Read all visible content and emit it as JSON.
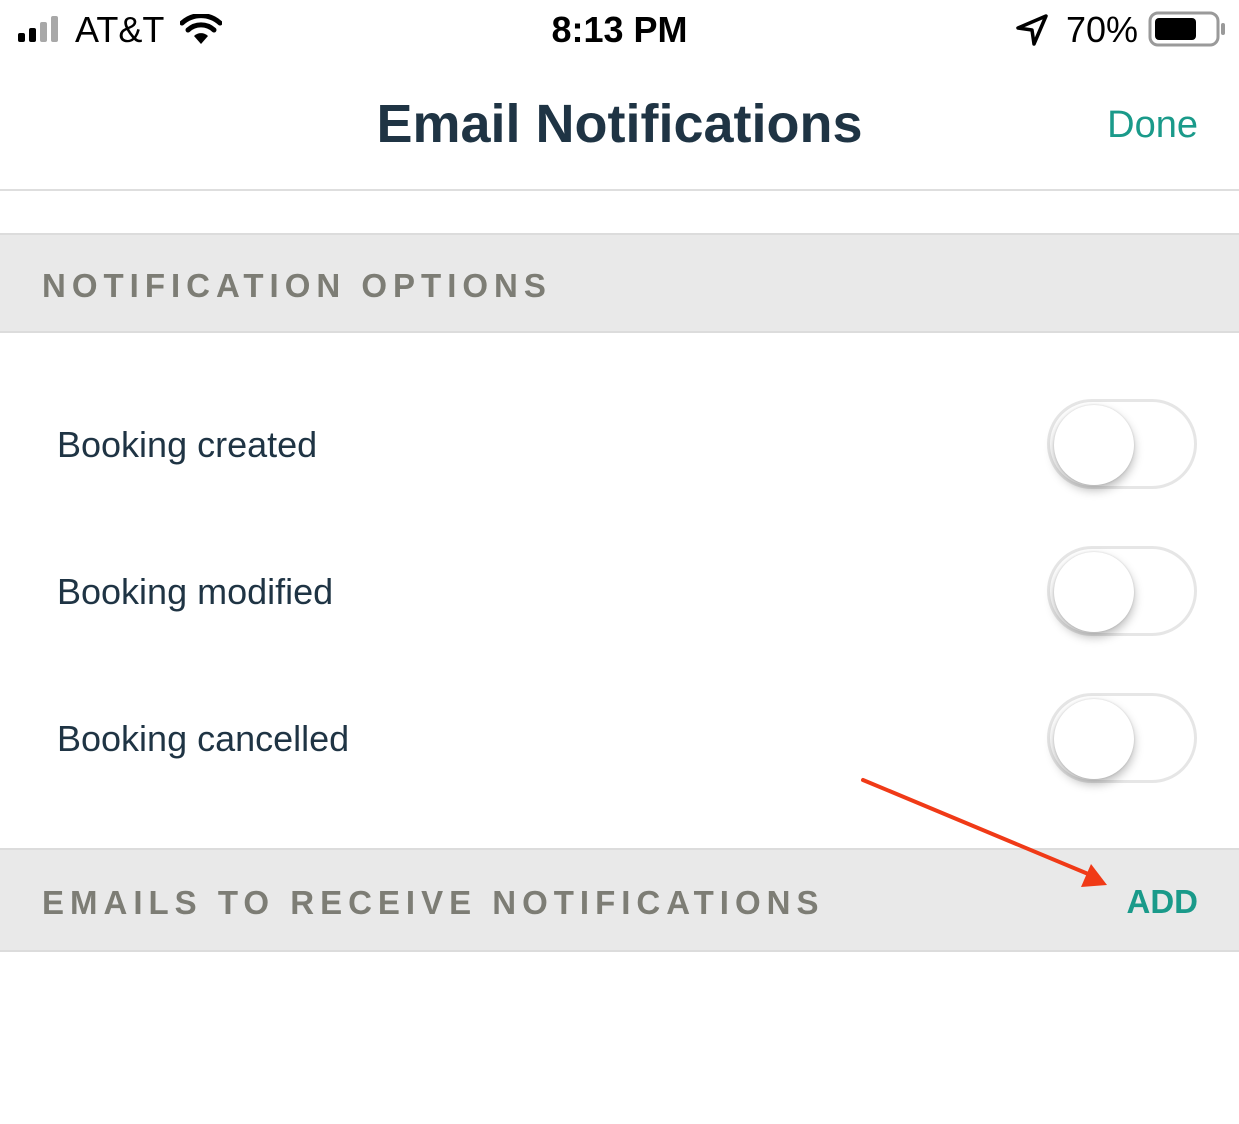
{
  "status_bar": {
    "carrier": "AT&T",
    "time": "8:13 PM",
    "battery_percent": "70%",
    "battery_level": 0.7,
    "icons": [
      "signal-icon",
      "wifi-icon",
      "location-arrow-icon",
      "battery-icon"
    ]
  },
  "nav": {
    "title": "Email Notifications",
    "done_label": "Done"
  },
  "sections": {
    "options_header": "NOTIFICATION OPTIONS",
    "emails_header": "EMAILS TO RECEIVE NOTIFICATIONS",
    "add_label": "ADD"
  },
  "options": [
    {
      "label": "Booking created",
      "enabled": false
    },
    {
      "label": "Booking modified",
      "enabled": false
    },
    {
      "label": "Booking cancelled",
      "enabled": false
    }
  ],
  "colors": {
    "accent": "#1a9a8a",
    "title_text": "#1f3444",
    "section_text": "#7d7d75",
    "section_bg": "#e9e9e9",
    "annotation_arrow": "#f03a17"
  }
}
